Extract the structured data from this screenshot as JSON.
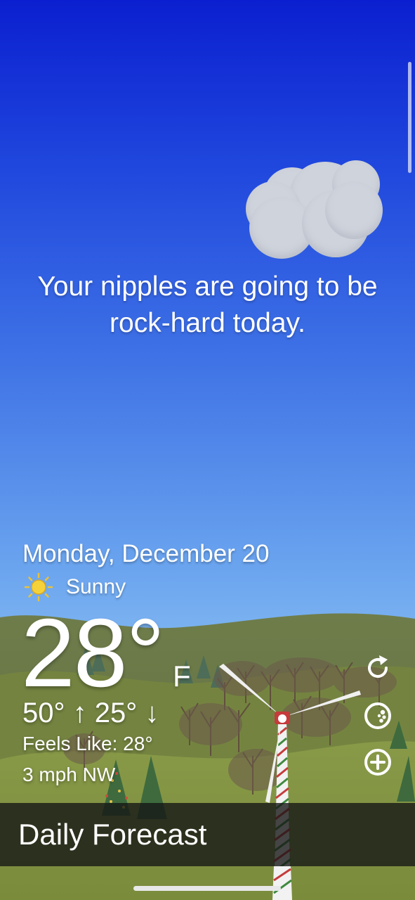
{
  "message": "Your nipples are going to be rock-hard today.",
  "weather": {
    "date": "Monday, December 20",
    "condition": "Sunny",
    "condition_icon": "sun-icon",
    "temperature": "28°",
    "unit": "F",
    "high_low": "50° ↑ 25° ↓",
    "feels_like": "Feels Like: 28°",
    "wind": "3 mph NW"
  },
  "controls": {
    "refresh_icon": "refresh-icon",
    "nut_icon": "nut-icon",
    "add_icon": "add-icon"
  },
  "forecast_bar": {
    "label": "Daily Forecast"
  }
}
